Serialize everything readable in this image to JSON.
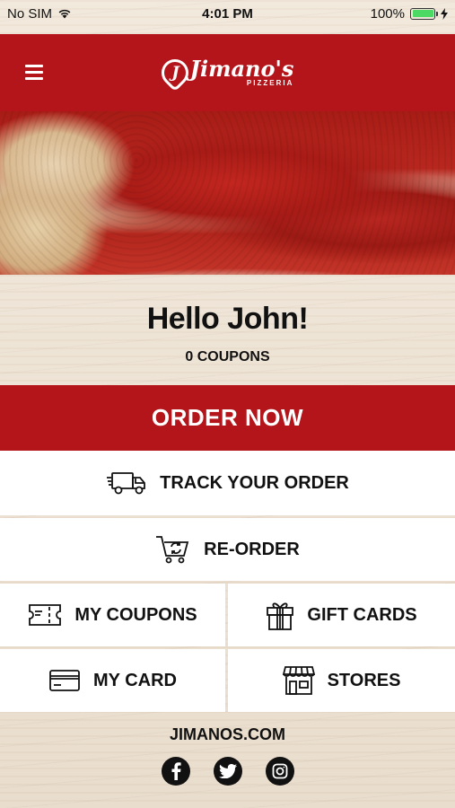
{
  "status_bar": {
    "carrier": "No SIM",
    "time": "4:01 PM",
    "battery": "100%",
    "battery_level": 1.0,
    "battery_color": "#4cd964"
  },
  "header": {
    "brand_name": "Jimano's",
    "brand_sub": "PIZZERIA",
    "brand_initial": "J",
    "bg_color": "#b3151b"
  },
  "greeting": {
    "title": "Hello John!",
    "coupons": "0 COUPONS"
  },
  "order_now": {
    "label": "ORDER NOW",
    "bg_color": "#b3151b"
  },
  "tiles": {
    "track": "TRACK YOUR ORDER",
    "reorder": "RE-ORDER",
    "coupons": "MY COUPONS",
    "gift": "GIFT CARDS",
    "card": "MY CARD",
    "stores": "STORES"
  },
  "footer": {
    "site": "JIMANOS.COM",
    "social": [
      {
        "icon": "facebook-icon",
        "glyph": "f"
      },
      {
        "icon": "twitter-icon",
        "glyph": "t"
      },
      {
        "icon": "instagram-icon",
        "glyph": "i"
      }
    ]
  }
}
